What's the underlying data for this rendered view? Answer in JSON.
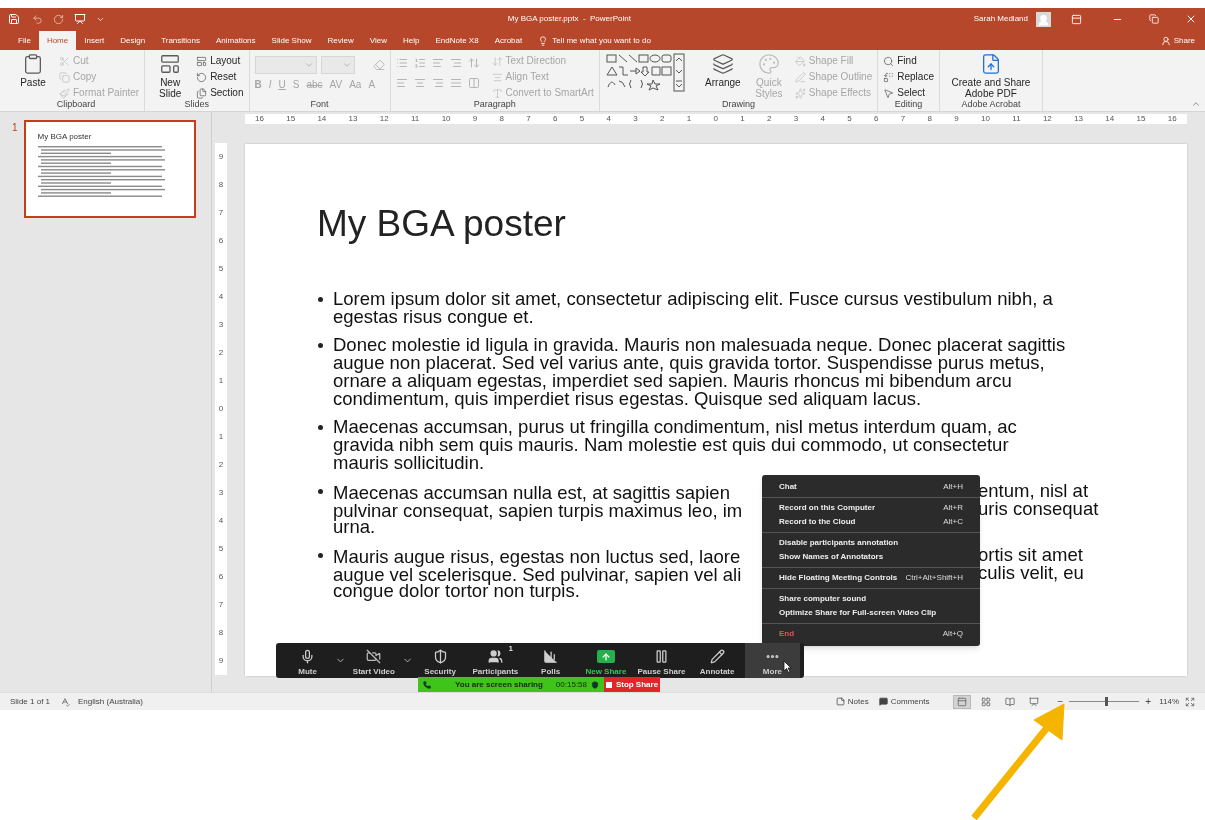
{
  "window": {
    "title": "My BGA poster.pptx  -  PowerPoint",
    "user": "Sarah Medland"
  },
  "tabs": [
    {
      "label": "File",
      "selected": false
    },
    {
      "label": "Home",
      "selected": true
    },
    {
      "label": "Insert",
      "selected": false
    },
    {
      "label": "Design",
      "selected": false
    },
    {
      "label": "Transitions",
      "selected": false
    },
    {
      "label": "Animations",
      "selected": false
    },
    {
      "label": "Slide Show",
      "selected": false
    },
    {
      "label": "Review",
      "selected": false
    },
    {
      "label": "View",
      "selected": false
    },
    {
      "label": "Help",
      "selected": false
    },
    {
      "label": "EndNote X8",
      "selected": false
    },
    {
      "label": "Acrobat",
      "selected": false
    }
  ],
  "tell_me": "Tell me what you want to do",
  "share": "Share",
  "ribbon": {
    "groups": [
      {
        "label": "Clipboard",
        "kind": "items",
        "items": [
          {
            "kind": "large",
            "label": "Paste",
            "disabled": false
          },
          {
            "kind": "small",
            "label": "Cut",
            "disabled": true
          },
          {
            "kind": "small",
            "label": "Copy",
            "disabled": true
          },
          {
            "kind": "small",
            "label": "Format Painter",
            "disabled": true
          }
        ]
      },
      {
        "label": "Slides",
        "kind": "items",
        "items": [
          {
            "kind": "large",
            "label": "New Slide",
            "disabled": false
          },
          {
            "kind": "small",
            "label": "Layout",
            "disabled": false
          },
          {
            "kind": "small",
            "label": "Reset",
            "disabled": false
          },
          {
            "kind": "small",
            "label": "Section",
            "disabled": false
          }
        ]
      },
      {
        "label": "Font",
        "kind": "font",
        "buttons": [
          "B",
          "I",
          "U",
          "S",
          "abc",
          "AV",
          "Aa",
          "A"
        ],
        "disabled": true
      },
      {
        "label": "Paragraph",
        "kind": "paragraph",
        "items": [
          {
            "kind": "small",
            "label": "Text Direction",
            "disabled": true
          },
          {
            "kind": "small",
            "label": "Align Text",
            "disabled": true
          },
          {
            "kind": "small",
            "label": "Convert to SmartArt",
            "disabled": true
          }
        ]
      },
      {
        "label": "Drawing",
        "kind": "drawing",
        "items": [
          {
            "kind": "large",
            "label": "Arrange",
            "disabled": false
          },
          {
            "kind": "large",
            "label": "Quick Styles",
            "disabled": true
          },
          {
            "kind": "small",
            "label": "Shape Fill",
            "disabled": true
          },
          {
            "kind": "small",
            "label": "Shape Outline",
            "disabled": true
          },
          {
            "kind": "small",
            "label": "Shape Effects",
            "disabled": true
          }
        ]
      },
      {
        "label": "Editing",
        "kind": "items",
        "items": [
          {
            "kind": "small",
            "label": "Find",
            "disabled": false
          },
          {
            "kind": "small",
            "label": "Replace",
            "disabled": false
          },
          {
            "kind": "small",
            "label": "Select",
            "disabled": false
          }
        ]
      },
      {
        "label": "Adobe Acrobat",
        "kind": "items",
        "items": [
          {
            "kind": "large",
            "label": "Create and Share Adobe PDF",
            "disabled": false
          }
        ]
      }
    ]
  },
  "thumbnails": [
    {
      "number": "1",
      "title": "My BGA poster",
      "selected": true
    }
  ],
  "rulers": {
    "horizontal": [
      "16",
      "15",
      "14",
      "13",
      "12",
      "11",
      "10",
      "9",
      "8",
      "7",
      "6",
      "5",
      "4",
      "3",
      "2",
      "1",
      "0",
      "1",
      "2",
      "3",
      "4",
      "5",
      "6",
      "7",
      "8",
      "9",
      "10",
      "11",
      "12",
      "13",
      "14",
      "15",
      "16"
    ],
    "vertical": [
      "9",
      "8",
      "7",
      "6",
      "5",
      "4",
      "3",
      "2",
      "1",
      "0",
      "1",
      "2",
      "3",
      "4",
      "5",
      "6",
      "7",
      "8",
      "9"
    ]
  },
  "slide": {
    "title": "My BGA poster",
    "bullets": [
      {
        "lines": [
          [
            "Lorem ipsum dolor sit amet, consectetur adipiscing elit. Fusce cursus vestibulum nibh, a"
          ],
          [
            "egestas risus congue et."
          ]
        ]
      },
      {
        "lines": [
          [
            "Donec molestie id ligula in gravida. Mauris non malesuada neque. Donec placerat sagittis"
          ],
          [
            "augue non placerat. Sed vel varius ante, quis gravida tortor. Suspendisse purus metus,"
          ],
          [
            "ornare a aliquam egestas, imperdiet sed sapien. Mauris rhoncus mi bibendum arcu"
          ],
          [
            "condimentum, quis imperdiet risus egestas. Quisque sed aliquam lacus."
          ]
        ]
      },
      {
        "lines": [
          [
            "Maecenas accumsan, purus ut fringilla condimentum, nisl metus interdum quam, ac"
          ],
          [
            "gravida nibh sem quis mauris. Nam molestie est quis dui commodo, ut consectetur"
          ],
          [
            "mauris sollicitudin."
          ]
        ]
      },
      {
        "lines": [
          [
            "Maecenas accumsan nulla est, at sagittis sapien",
            "entum, nisl at"
          ],
          [
            "pulvinar consequat, sapien turpis maximus leo, im",
            "uris consequat"
          ],
          [
            "urna."
          ]
        ]
      },
      {
        "lines": [
          [
            "Mauris augue risus, egestas non luctus sed, laore",
            "ortis sit amet"
          ],
          [
            "augue vel scelerisque. Sed pulvinar, sapien vel ali",
            "culis velit, eu"
          ],
          [
            "congue dolor tortor non turpis."
          ]
        ]
      }
    ]
  },
  "meeting_controls": [
    {
      "label": "Mute",
      "kind": "normal",
      "menu": true,
      "selected": false
    },
    {
      "label": "Start Video",
      "kind": "normal",
      "menu": true,
      "selected": false
    },
    {
      "label": "Security",
      "kind": "normal",
      "menu": false,
      "selected": false
    },
    {
      "label": "Participants",
      "kind": "normal",
      "menu": false,
      "selected": false,
      "badge": "1"
    },
    {
      "label": "Polls",
      "kind": "normal",
      "menu": false,
      "selected": false
    },
    {
      "label": "New Share",
      "kind": "share",
      "menu": false,
      "selected": false
    },
    {
      "label": "Pause Share",
      "kind": "normal",
      "menu": false,
      "selected": false
    },
    {
      "label": "Annotate",
      "kind": "normal",
      "menu": false,
      "selected": false
    },
    {
      "label": "More",
      "kind": "normal",
      "menu": false,
      "selected": true
    }
  ],
  "sharing_bar": {
    "status": "You are screen sharing",
    "time": "00:15:58",
    "stop": "Stop Share"
  },
  "more_menu": [
    [
      {
        "label": "Chat",
        "shortcut": "Alt+H",
        "kind": "normal"
      }
    ],
    [
      {
        "label": "Record on this Computer",
        "shortcut": "Alt+R",
        "kind": "normal"
      },
      {
        "label": "Record to the Cloud",
        "shortcut": "Alt+C",
        "kind": "normal"
      }
    ],
    [
      {
        "label": "Disable participants annotation",
        "kind": "normal"
      },
      {
        "label": "Show Names of Annotators",
        "kind": "normal"
      }
    ],
    [
      {
        "label": "Hide Floating Meeting Controls",
        "shortcut": "Ctrl+Alt+Shift+H",
        "kind": "normal"
      }
    ],
    [
      {
        "label": "Share computer sound",
        "kind": "normal"
      },
      {
        "label": "Optimize Share for Full-screen Video Clip",
        "kind": "normal"
      }
    ],
    [
      {
        "label": "End",
        "shortcut": "Alt+Q",
        "kind": "danger"
      }
    ]
  ],
  "status_bar": {
    "slide": "Slide 1 of 1",
    "language": "English (Australia)",
    "notes": "Notes",
    "comments": "Comments",
    "views": [
      {
        "selected": true
      },
      {
        "selected": false
      },
      {
        "selected": false
      },
      {
        "selected": false
      }
    ],
    "zoom_out": "−",
    "zoom_in": "+",
    "zoom": {
      "level": 0.52
    },
    "zoom_value": "114%"
  }
}
